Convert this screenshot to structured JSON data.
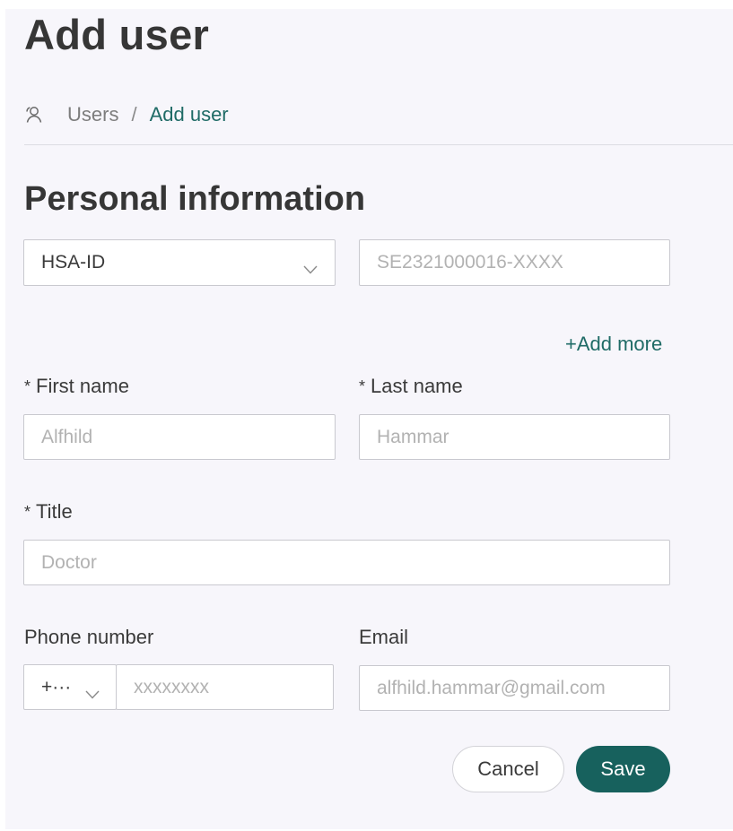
{
  "header": {
    "title": "Add user"
  },
  "breadcrumb": {
    "icon": "users-icon",
    "items": [
      "Users",
      "Add user"
    ],
    "separator": "/"
  },
  "section": {
    "title": "Personal information"
  },
  "id_field": {
    "type_selected": "HSA-ID",
    "placeholder": "SE2321000016-XXXX",
    "add_more_label": "+Add more"
  },
  "fields": {
    "first_name": {
      "label": "First name",
      "required_mark": "*",
      "placeholder": "Alfhild"
    },
    "last_name": {
      "label": "Last name",
      "required_mark": "*",
      "placeholder": "Hammar"
    },
    "title": {
      "label": "Title",
      "required_mark": "*",
      "placeholder": "Doctor"
    },
    "phone": {
      "label": "Phone number",
      "country_code": "+···",
      "placeholder": "xxxxxxxx"
    },
    "email": {
      "label": "Email",
      "placeholder": "alfhild.hammar@gmail.com"
    }
  },
  "actions": {
    "cancel_label": "Cancel",
    "save_label": "Save"
  },
  "colors": {
    "accent": "#17615d",
    "link": "#1f6b66",
    "panel_background": "#f7f6fb"
  }
}
